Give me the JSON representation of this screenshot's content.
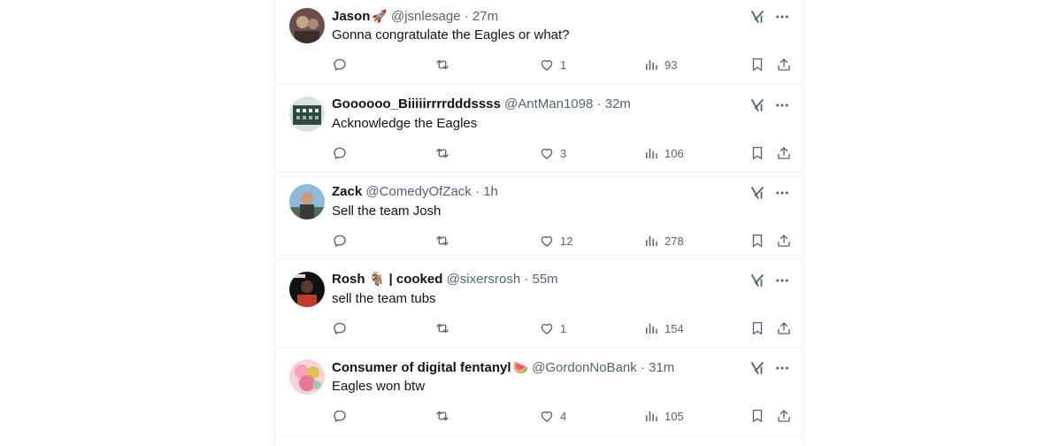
{
  "tweets": [
    {
      "name": "Jason",
      "emoji": "🚀",
      "handle": "@jsnlesage",
      "time": "27m",
      "text": "Gonna congratulate the Eagles or what?",
      "likes": "1",
      "views": "93",
      "avatar_colors": [
        "#6b4f4a",
        "#c9a38a"
      ]
    },
    {
      "name": "Goooooo_Biiiiirrrrdddssss",
      "emoji": "",
      "handle": "@AntMan1098",
      "time": "32m",
      "text": "Acknowledge the Eagles",
      "likes": "3",
      "views": "106",
      "avatar_colors": [
        "#2e4a3e",
        "#9fb3ad"
      ]
    },
    {
      "name": "Zack",
      "emoji": "",
      "handle": "@ComedyOfZack",
      "time": "1h",
      "text": "Sell the team Josh",
      "likes": "12",
      "views": "278",
      "avatar_colors": [
        "#6aa0c8",
        "#3a3a3a"
      ]
    },
    {
      "name": "Rosh",
      "emoji": "🐐 | cooked",
      "handle": "@sixersrosh",
      "time": "55m",
      "text": "sell the team tubs",
      "likes": "1",
      "views": "154",
      "avatar_colors": [
        "#111111",
        "#c0392b"
      ]
    },
    {
      "name": "Consumer of digital fentanyl",
      "emoji": "🍉",
      "handle": "@GordonNoBank",
      "time": "31m",
      "text": "Eagles won btw",
      "likes": "4",
      "views": "105",
      "avatar_colors": [
        "#f4a3b4",
        "#e5c04d"
      ]
    }
  ],
  "separator": "·",
  "icons": {
    "grok": "grok-icon",
    "more": "more-icon",
    "reply": "reply-icon",
    "repost": "repost-icon",
    "like": "heart-icon",
    "views": "views-icon",
    "bookmark": "bookmark-icon",
    "share": "share-icon"
  },
  "colors": {
    "icon": "#536471",
    "text": "#0f1419",
    "border": "#eff3f4"
  }
}
